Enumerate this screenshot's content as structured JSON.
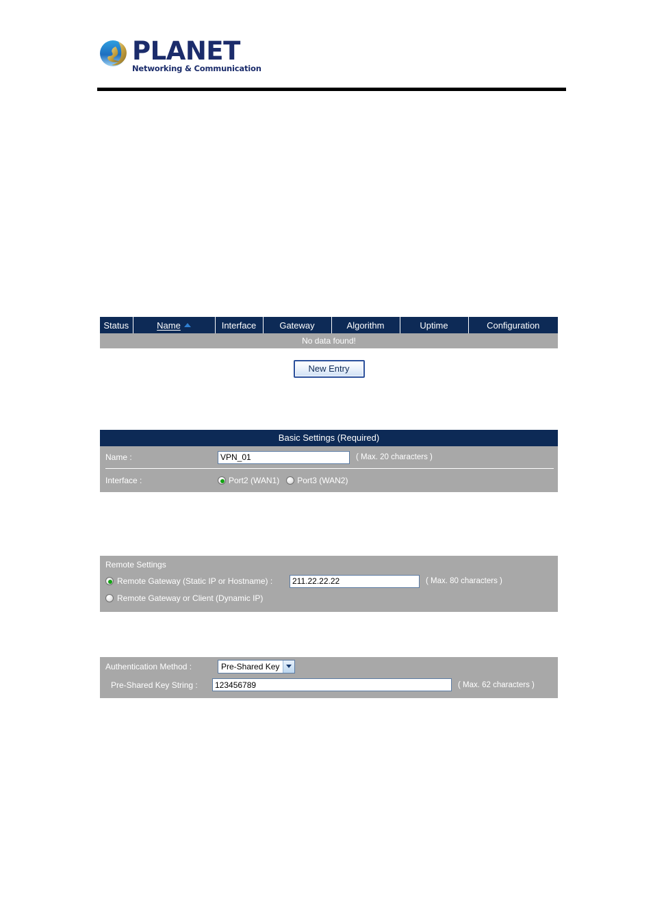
{
  "brand": {
    "name": "PLANET",
    "tagline": "Networking & Communication",
    "logo_icon": "globe-swoosh-icon",
    "brand_color": "#1b2c6b"
  },
  "theme": {
    "header_navy": "#0d2a56",
    "panel_gray": "#a8a8a8",
    "radio_selected": "#12a312",
    "sort_arrow": "#2f7fd1"
  },
  "vpn_list": {
    "columns": [
      {
        "label": "Status",
        "sorted": false
      },
      {
        "label": "Name",
        "sorted": true,
        "sort_direction": "asc",
        "sort_icon": "sort-ascending-triangle-icon"
      },
      {
        "label": "Interface",
        "sorted": false
      },
      {
        "label": "Gateway",
        "sorted": false
      },
      {
        "label": "Algorithm",
        "sorted": false
      },
      {
        "label": "Uptime",
        "sorted": false
      },
      {
        "label": "Configuration",
        "sorted": false
      }
    ],
    "empty_message": "No data found!",
    "new_entry_label": "New Entry"
  },
  "basic_settings": {
    "title": "Basic Settings (Required)",
    "name": {
      "label": "Name :",
      "value": "VPN_01",
      "hint": "( Max. 20 characters )"
    },
    "interface": {
      "label": "Interface :",
      "options": [
        {
          "label": "Port2 (WAN1)",
          "selected": true
        },
        {
          "label": "Port3 (WAN2)",
          "selected": false
        }
      ]
    }
  },
  "remote_settings": {
    "section_label": "Remote Settings",
    "gateway_static": {
      "label": "Remote Gateway (Static IP or Hostname) :",
      "selected": true,
      "value": "211.22.22.22",
      "hint": "( Max. 80 characters )"
    },
    "gateway_dynamic": {
      "label": "Remote Gateway or Client (Dynamic IP)",
      "selected": false
    }
  },
  "authentication": {
    "method": {
      "label": "Authentication Method :",
      "selected": "Pre-Shared Key",
      "dropdown_icon": "chevron-down-icon"
    },
    "preshared_key": {
      "label": "Pre-Shared Key String :",
      "value": "123456789",
      "hint": "( Max. 62 characters )"
    }
  }
}
